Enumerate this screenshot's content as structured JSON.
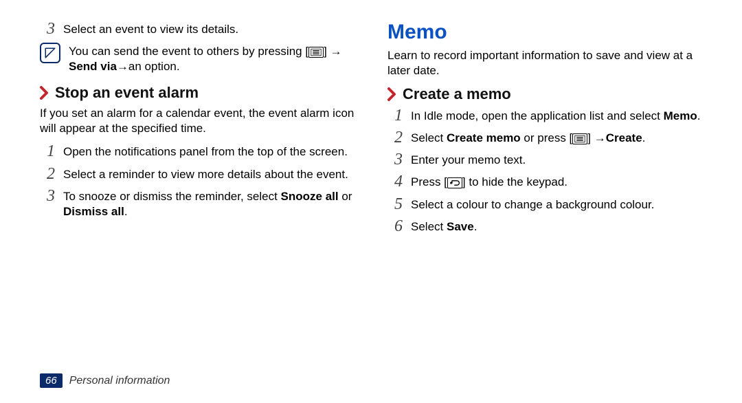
{
  "left": {
    "step3": "Select an event to view its details.",
    "note_prefix": "You can send the event to others by pressing [",
    "note_mid": "] ",
    "note_arrow1": "→ ",
    "note_bold": "Send via",
    "note_arrow2": " → ",
    "note_suffix": "an option.",
    "sub_heading": "Stop an event alarm",
    "intro": "If you set an alarm for a calendar event, the event alarm icon will appear at the specified time.",
    "s1": "Open the notifications panel from the top of the screen.",
    "s2": "Select a reminder to view more details about the event.",
    "s3_a": "To snooze or dismiss the reminder, select ",
    "s3_b1": "Snooze all",
    "s3_mid": " or ",
    "s3_b2": "Dismiss all",
    "s3_end": "."
  },
  "right": {
    "title": "Memo",
    "intro": "Learn to record important information to save and view at a later date.",
    "sub_heading": "Create a memo",
    "s1_a": "In Idle mode, open the application list and select ",
    "s1_b": "Memo",
    "s1_end": ".",
    "s2_a": "Select ",
    "s2_b1": "Create memo",
    "s2_mid": " or press [",
    "s2_after_icon": "] ",
    "s2_arrow": "→ ",
    "s2_b2": "Create",
    "s2_end": ".",
    "s3": "Enter your memo text.",
    "s4_a": "Press [",
    "s4_b": "] to hide the keypad.",
    "s5": "Select a colour to change a background colour.",
    "s6_a": "Select ",
    "s6_b": "Save",
    "s6_end": "."
  },
  "nums": {
    "n1": "1",
    "n2": "2",
    "n3": "3",
    "n4": "4",
    "n5": "5",
    "n6": "6"
  },
  "footer": {
    "page": "66",
    "chapter": "Personal information"
  }
}
